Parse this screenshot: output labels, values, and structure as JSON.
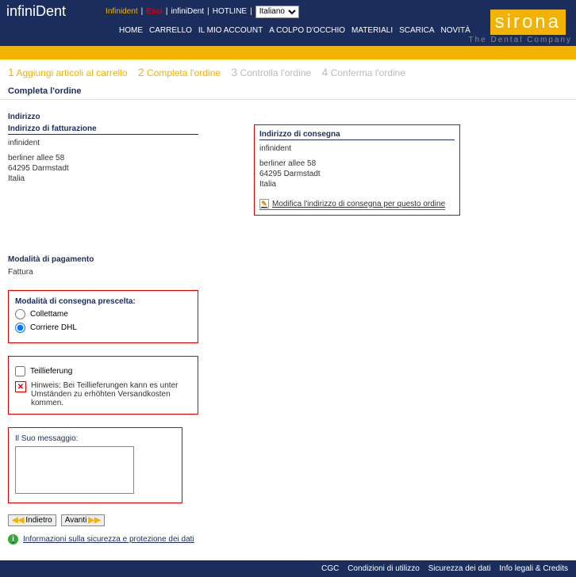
{
  "header": {
    "brand": "infiniDent",
    "toplinks": {
      "infinident": "Infinident",
      "esci": "Esci",
      "infinident2": "infiniDent",
      "hotline": "HOTLINE"
    },
    "language_selected": "Italiano",
    "nav": {
      "home": "HOME",
      "carrello": "CARRELLO",
      "account": "IL MIO ACCOUNT",
      "colpo": "A COLPO D'OCCHIO",
      "materiali": "MATERIALI",
      "scarica": "SCARICA",
      "novita": "NOVITÀ"
    },
    "logo": {
      "name": "sirona",
      "sub": "The Dental Company"
    }
  },
  "steps": {
    "s1_num": "1",
    "s1_label": "Aggiungi articoli al carrello",
    "s2_num": "2",
    "s2_label": "Completa l'ordine",
    "s3_num": "3",
    "s3_label": "Controlla l'ordine",
    "s4_num": "4",
    "s4_label": "Conferma l'ordine"
  },
  "page_title": "Completa l'ordine",
  "address_section": {
    "title": "Indirizzo",
    "billing": {
      "title": "Indirizzo di fatturazione",
      "name": "infinident",
      "line1": "berliner allee 58",
      "line2": "64295 Darmstadt",
      "line3": "Italia"
    },
    "delivery": {
      "title": "Indirizzo di consegna",
      "name": "infinident",
      "line1": "berliner allee 58",
      "line2": "64295 Darmstadt",
      "line3": "Italia",
      "modify": "Modifica l'indirizzo di consegna per questo ordine"
    }
  },
  "payment": {
    "title": "Modalità di pagamento",
    "value": "Fattura"
  },
  "shipping": {
    "title": "Modalità di consegna prescelta:",
    "opt1": "Collettame",
    "opt2": "Corriere DHL",
    "selected": "opt2"
  },
  "partial": {
    "label": "Teillieferung",
    "hint": "Hinweis: Bei Teillieferungen kann es unter Umständen zu erhöhten Versandkosten kommen."
  },
  "message": {
    "label": "Il Suo messaggio:",
    "value": ""
  },
  "buttons": {
    "back": "Indietro",
    "next": "Avanti"
  },
  "security_link": "Informazioni sulla sicurezza e protezione dei dati",
  "footer": {
    "cgc": "CGC",
    "cond": "Condizioni di utilizzo",
    "sic": "Sicurezza dei dati",
    "info": "Info legali & Credits"
  }
}
